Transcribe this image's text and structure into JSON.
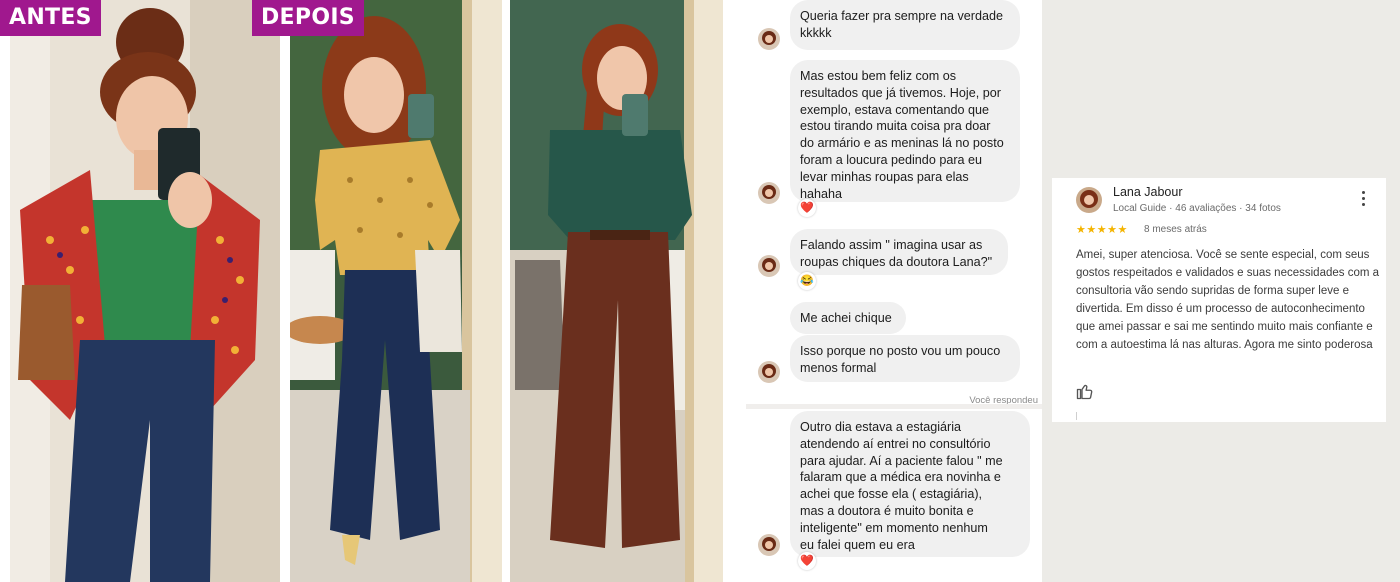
{
  "labels": {
    "before": "ANTES",
    "after": "DEPOIS"
  },
  "chat": {
    "messages": [
      {
        "text": "Queria fazer pra sempre na verdade\nkkkkk"
      },
      {
        "text": "Mas estou bem feliz com os\nresultados que já tivemos. Hoje, por\nexemplo, estava comentando que\nestou tirando muita coisa pra doar\ndo armário e as meninas lá no posto\nforam a loucura pedindo para eu\nlevar minhas roupas para elas\nhahaha"
      },
      {
        "text": "Falando assim \" imagina usar as\nroupas chiques da doutora Lana?\""
      },
      {
        "text": "Me achei chique"
      },
      {
        "text": "Isso porque no posto vou um pouco\nmenos formal"
      },
      {
        "text": "Outro dia estava a estagiária\natendendo aí entrei no consultório\npara ajudar. Aí a paciente falou \" me\nfalaram que a médica era novinha e\nachei que fosse ela ( estagiária),\nmas a doutora é muito bonita e\ninteligente\" em momento nenhum\neu falei quem eu era"
      }
    ],
    "reactions": {
      "heart": "❤️",
      "laugh": "😂"
    },
    "replied_label": "Você respondeu"
  },
  "review": {
    "name": "Lana Jabour",
    "meta": "Local Guide · 46 avaliações · 34 fotos",
    "rating": 5,
    "stars": "★★★★★",
    "time": "8 meses atrás",
    "text": "Amei, super atenciosa. Você se sente especial, com seus gostos respeitados e validados e suas necessidades com a consultoria vão sendo supridas de forma super leve e divertida. Em disso é um processo de autoconhecimento que amei passar e sai me sentindo muito mais confiante e com a autoestima lá nas alturas. Agora me sinto poderosa"
  },
  "colors": {
    "tag": "#a0188e",
    "bubble": "#f0f0f0",
    "star": "#f4b400"
  }
}
